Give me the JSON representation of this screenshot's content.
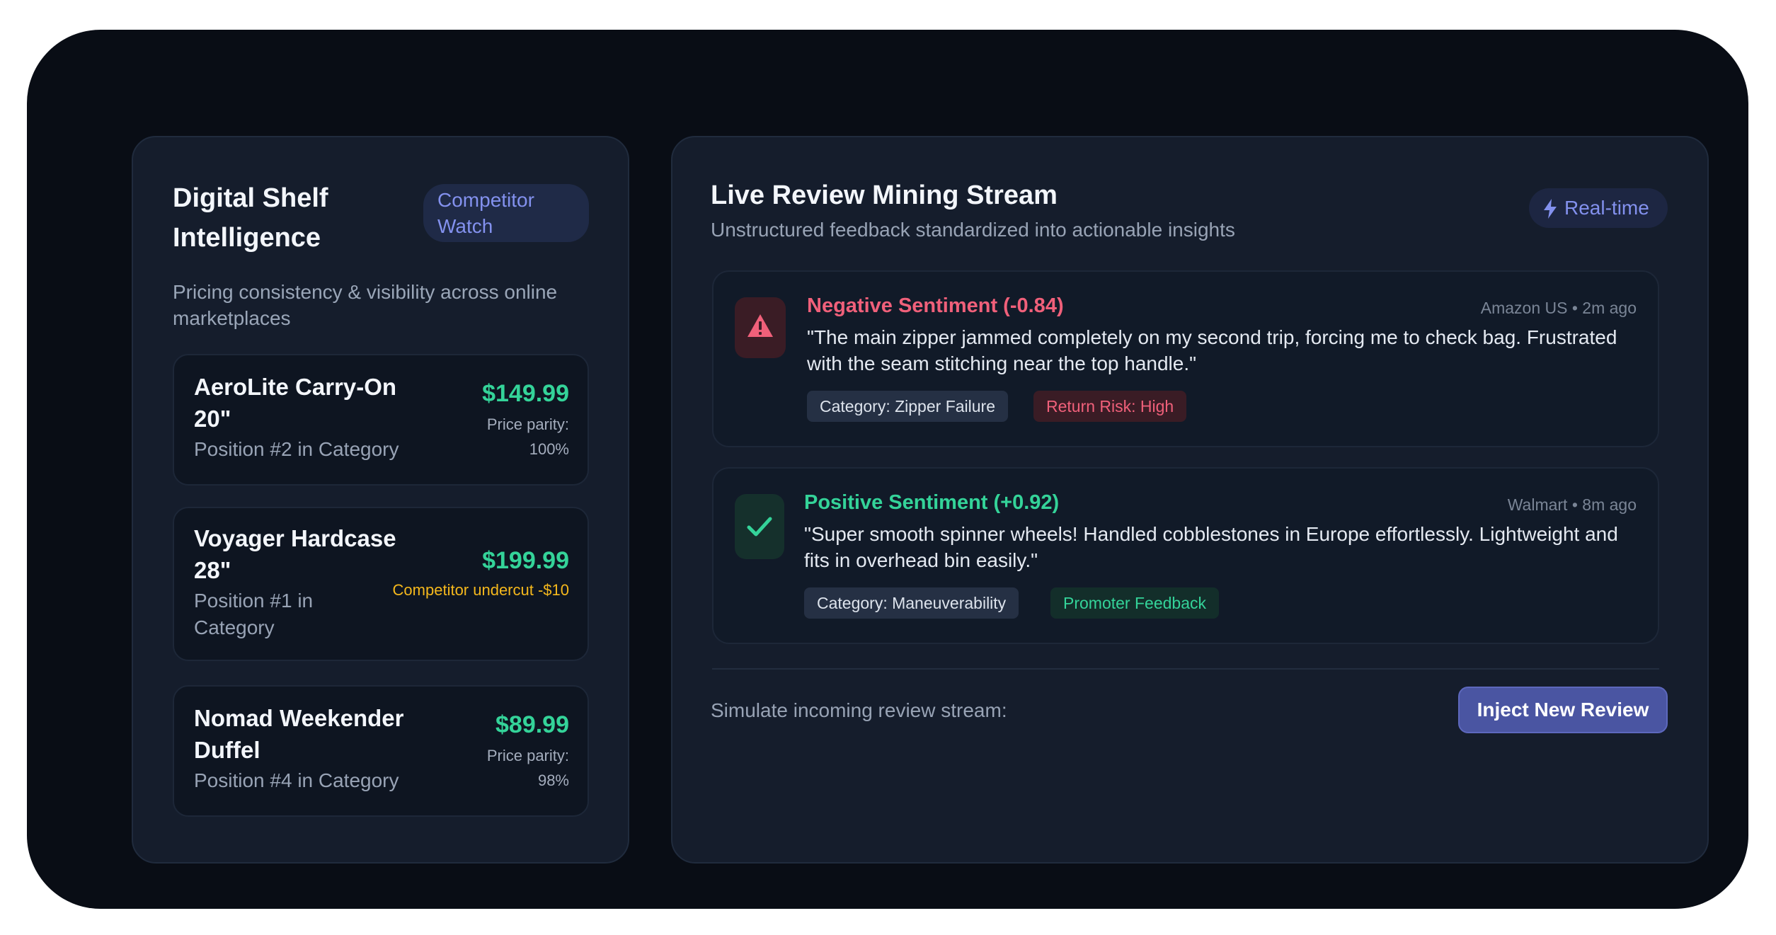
{
  "shelf": {
    "title": "Digital Shelf Intelligence",
    "badge": "Competitor Watch",
    "description": "Pricing consistency & visibility across online marketplaces",
    "products": [
      {
        "name": "AeroLite Carry-On 20\"",
        "position": "Position #2 in Category",
        "price": "$149.99",
        "note": "Price parity: 100%"
      },
      {
        "name": "Voyager Hardcase 28\"",
        "position": "Position #1 in Category",
        "price": "$199.99",
        "note": "Competitor undercut -$10"
      },
      {
        "name": "Nomad Weekender Duffel",
        "position": "Position #4 in Category",
        "price": "$89.99",
        "note": "Price parity: 98%"
      }
    ]
  },
  "stream": {
    "title": "Live Review Mining Stream",
    "subtitle": "Unstructured feedback standardized into actionable insights",
    "badge": "Real-time",
    "reviews": [
      {
        "sentiment": "Negative Sentiment (-0.84)",
        "meta": "Amazon US • 2m ago",
        "quote": "\"The main zipper jammed completely on my second trip, forcing me to check bag. Frustrated with the seam stitching near the top handle.\"",
        "tags": [
          "Category: Zipper Failure",
          "Return Risk: High"
        ]
      },
      {
        "sentiment": "Positive Sentiment (+0.92)",
        "meta": "Walmart • 8m ago",
        "quote": "\"Super smooth spinner wheels! Handled cobblestones in Europe effortlessly. Lightweight and fits in overhead bin easily.\"",
        "tags": [
          "Category: Maneuverability",
          "Promoter Feedback"
        ]
      }
    ],
    "simulate_label": "Simulate incoming review stream:",
    "inject_button": "Inject New Review"
  },
  "colors": {
    "accent": "#4a55a2",
    "positive": "#34d399",
    "negative": "#f0607a",
    "warning": "#f5b81c"
  }
}
